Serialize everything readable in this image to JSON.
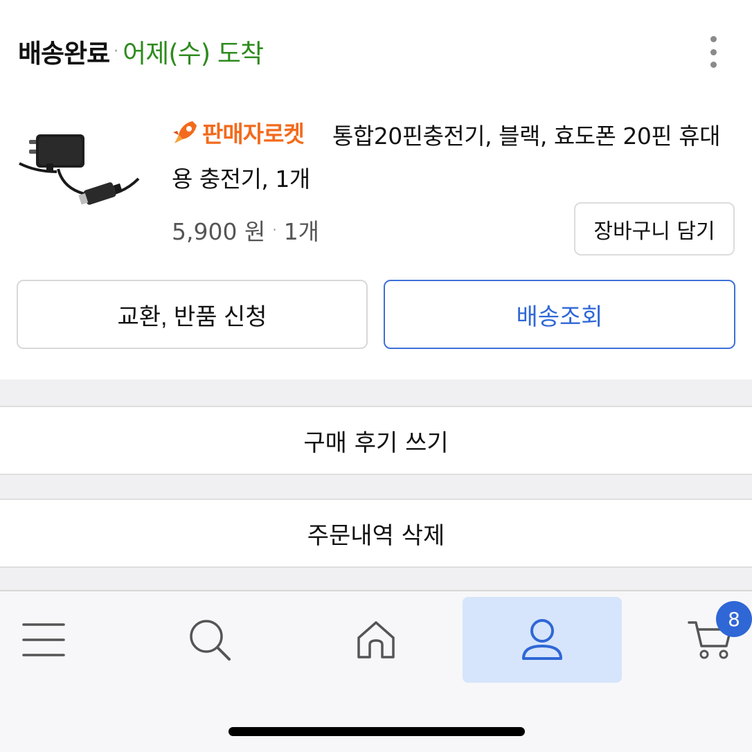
{
  "order": {
    "status": "배송완료",
    "arrival": "어제(수) 도착"
  },
  "product": {
    "badge": "판매자로켓",
    "title": "통합20핀충전기, 블랙, 효도폰 20핀 휴대용 충전기, 1개",
    "price": "5,900 원",
    "quantity": "1개",
    "cart_button": "장바구니 담기"
  },
  "actions": {
    "exchange": "교환, 반품 신청",
    "track": "배송조회",
    "review": "구매 후기 쓰기",
    "delete": "주문내역 삭제"
  },
  "nav": {
    "items": [
      {
        "icon": "menu-icon"
      },
      {
        "icon": "search-icon"
      },
      {
        "icon": "home-icon"
      },
      {
        "icon": "user-icon",
        "active": true
      },
      {
        "icon": "cart-icon"
      }
    ],
    "cart_count": "8"
  },
  "colors": {
    "accent_blue": "#2f67d6",
    "arrival_green": "#2e8b1e",
    "rocket_orange": "#f26b1d",
    "active_tab_bg": "#d6e5fb"
  }
}
